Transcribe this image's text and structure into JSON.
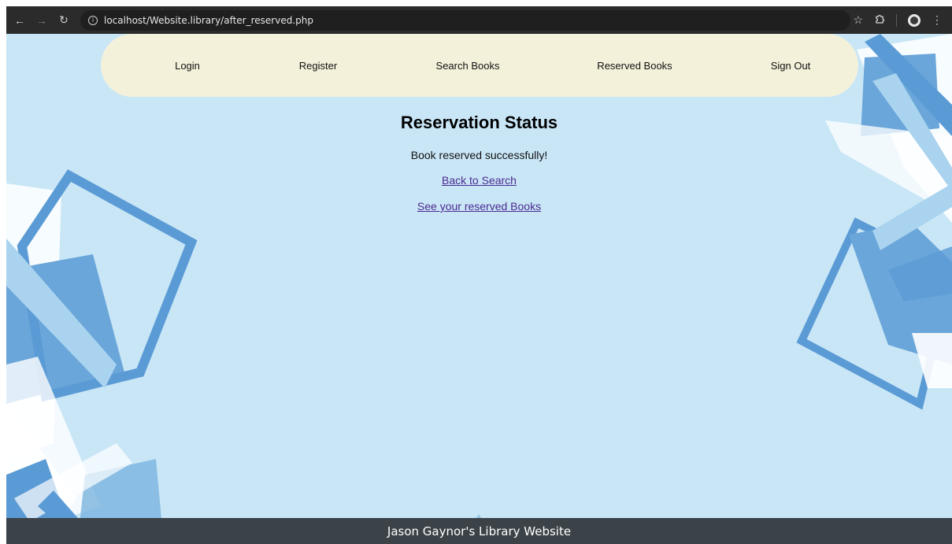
{
  "browser": {
    "url": "localhost/Website.library/after_reserved.php",
    "icons": {
      "back": "arrow-left-icon",
      "forward": "arrow-right-icon",
      "reload": "reload-icon",
      "info": "info-icon",
      "bookmark": "star-icon",
      "extensions": "puzzle-icon",
      "profile": "avatar",
      "menu": "kebab-menu-icon"
    }
  },
  "navbar": {
    "items": [
      {
        "label": "Login"
      },
      {
        "label": "Register"
      },
      {
        "label": "Search Books"
      },
      {
        "label": "Reserved Books"
      },
      {
        "label": "Sign Out"
      }
    ]
  },
  "main": {
    "title": "Reservation Status",
    "message": "Book reserved successfully!",
    "links": [
      {
        "label": "Back to Search"
      },
      {
        "label": "See your reserved Books"
      }
    ]
  },
  "footer": {
    "text": "Jason Gaynor's Library Website"
  },
  "colors": {
    "page_background": "#c9e6f7",
    "navbar_background": "#f4f1da",
    "footer_background": "#3c4348",
    "link_color": "#4b2a8f",
    "accent_blue": "#5b9bd5"
  }
}
